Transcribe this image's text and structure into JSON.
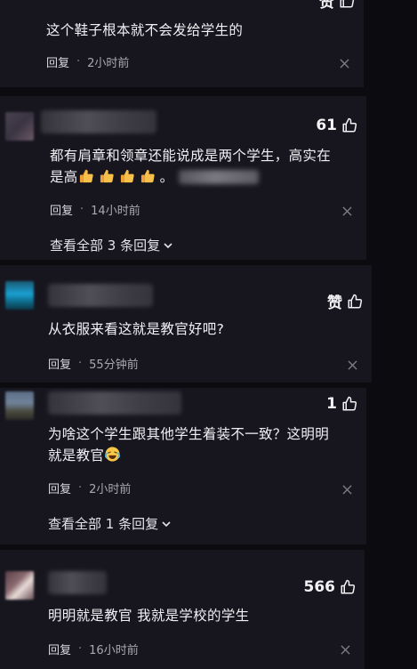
{
  "comments": [
    {
      "like_label": "赞",
      "text": "这个鞋子根本就不会发给学生的",
      "reply_label": "回复",
      "time": "2小时前"
    },
    {
      "like_label": "61",
      "text_line1": "都有肩章和领章还能说成是两个学生，高实在",
      "text_line2_prefix": "是高",
      "text_line2_suffix": "。",
      "reply_label": "回复",
      "time": "14小时前",
      "view_all": "查看全部 3 条回复"
    },
    {
      "like_label": "赞",
      "text": "从衣服来看这就是教官好吧?",
      "reply_label": "回复",
      "time": "55分钟前"
    },
    {
      "like_label": "1",
      "text_line1": "为啥这个学生跟其他学生着装不一致？这明明",
      "text_line2_prefix": "就是教官",
      "reply_label": "回复",
      "time": "2小时前",
      "view_all": "查看全部 1 条回复"
    },
    {
      "like_label": "566",
      "text": "明明就是教官 我就是学校的学生",
      "reply_label": "回复",
      "time": "16小时前"
    }
  ],
  "separator": "·",
  "icons": {
    "like": "thumbs-up-icon",
    "close": "close-icon",
    "expand": "chevron-down-icon",
    "thumbs_emoji": "thumbs-up-emoji",
    "laugh_emoji": "laughing-crying-emoji"
  }
}
